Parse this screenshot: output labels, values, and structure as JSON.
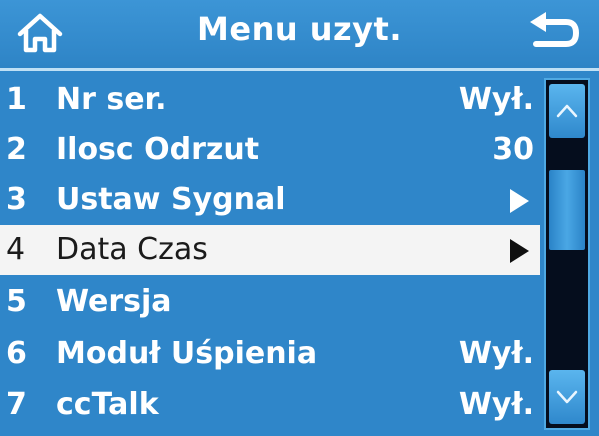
{
  "header": {
    "title": "Menu uzyt.",
    "home_icon": "home-icon",
    "back_icon": "back-arrow-icon"
  },
  "menu": {
    "items": [
      {
        "num": "1",
        "label": "Nr ser.",
        "value": "Wył.",
        "type": "value"
      },
      {
        "num": "2",
        "label": "Ilosc Odrzut",
        "value": "30",
        "type": "value"
      },
      {
        "num": "3",
        "label": "Ustaw Sygnal",
        "value": "",
        "type": "submenu"
      },
      {
        "num": "4",
        "label": "Data Czas",
        "value": "",
        "type": "submenu",
        "selected": true
      },
      {
        "num": "5",
        "label": "Wersja",
        "value": "",
        "type": "plain"
      },
      {
        "num": "6",
        "label": "Moduł Uśpienia",
        "value": "Wył.",
        "type": "value"
      },
      {
        "num": "7",
        "label": "ccTalk",
        "value": "Wył.",
        "type": "value"
      }
    ]
  },
  "scrollbar": {
    "up_icon": "chevron-up-icon",
    "down_icon": "chevron-down-icon"
  },
  "colors": {
    "background": "#2f86c9",
    "selected_row": "#f4f4f4",
    "scroll_track": "#050d1d",
    "text": "#ffffff"
  }
}
